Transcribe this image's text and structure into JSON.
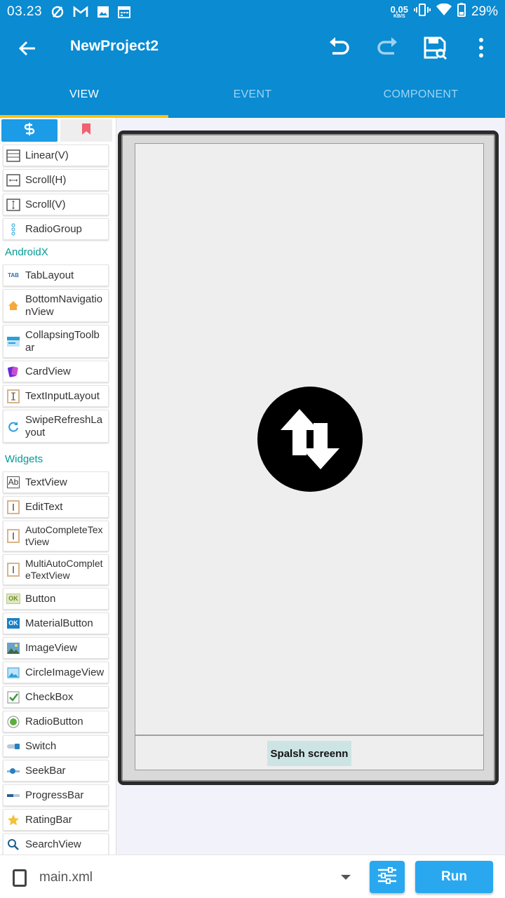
{
  "statusbar": {
    "time": "03.23",
    "speed_value": "0,05",
    "speed_unit": "KB/S",
    "battery": "29%"
  },
  "appbar": {
    "title": "NewProject2",
    "icons": [
      "back-arrow-icon",
      "undo-icon",
      "redo-icon",
      "save-icon",
      "more-vert-icon"
    ]
  },
  "tabs": [
    {
      "label": "VIEW",
      "active": true
    },
    {
      "label": "EVENT",
      "active": false
    },
    {
      "label": "COMPONENT",
      "active": false
    }
  ],
  "palette": {
    "tab_icons": [
      "palette-icon",
      "bookmark-icon"
    ],
    "layouts": [
      {
        "label": "Linear(V)",
        "icon": "linear-vertical-icon"
      },
      {
        "label": "Scroll(H)",
        "icon": "scroll-horizontal-icon"
      },
      {
        "label": "Scroll(V)",
        "icon": "scroll-vertical-icon"
      },
      {
        "label": "RadioGroup",
        "icon": "radiogroup-icon"
      }
    ],
    "androidx_title": "AndroidX",
    "androidx": [
      {
        "label": "TabLayout",
        "icon": "tab-icon",
        "badge": "TAB"
      },
      {
        "label": "BottomNavigationView",
        "icon": "home-icon",
        "badge": "Home"
      },
      {
        "label": "CollapsingToolbar",
        "icon": "toolbar-icon"
      },
      {
        "label": "CardView",
        "icon": "cardview-icon"
      },
      {
        "label": "TextInputLayout",
        "icon": "textinput-icon"
      },
      {
        "label": "SwipeRefreshLayout",
        "icon": "refresh-icon"
      }
    ],
    "widgets_title": "Widgets",
    "widgets": [
      {
        "label": "TextView",
        "icon": "textview-icon",
        "badge": "Ab"
      },
      {
        "label": "EditText",
        "icon": "edittext-icon"
      },
      {
        "label": "AutoCompleteTextView",
        "icon": "autocomplete-icon"
      },
      {
        "label": "MultiAutoCompleteTextView",
        "icon": "multiautocomplete-icon"
      },
      {
        "label": "Button",
        "icon": "button-icon",
        "badge": "OK"
      },
      {
        "label": "MaterialButton",
        "icon": "materialbutton-icon",
        "badge": "OK"
      },
      {
        "label": "ImageView",
        "icon": "imageview-icon"
      },
      {
        "label": "CircleImageView",
        "icon": "circleimage-icon"
      },
      {
        "label": "CheckBox",
        "icon": "checkbox-icon"
      },
      {
        "label": "RadioButton",
        "icon": "radiobutton-icon"
      },
      {
        "label": "Switch",
        "icon": "switch-icon"
      },
      {
        "label": "SeekBar",
        "icon": "seekbar-icon"
      },
      {
        "label": "ProgressBar",
        "icon": "progressbar-icon"
      },
      {
        "label": "RatingBar",
        "icon": "star-icon"
      },
      {
        "label": "SearchView",
        "icon": "search-icon"
      }
    ]
  },
  "canvas": {
    "center_icon": "swap-vertical-icon",
    "splash_button": "Spalsh screenn"
  },
  "bottombar": {
    "file": "main.xml",
    "run": "Run"
  },
  "colors": {
    "primary": "#0a8bd2",
    "accent": "#ffc107",
    "section": "#009b96",
    "button": "#29a8ef"
  }
}
